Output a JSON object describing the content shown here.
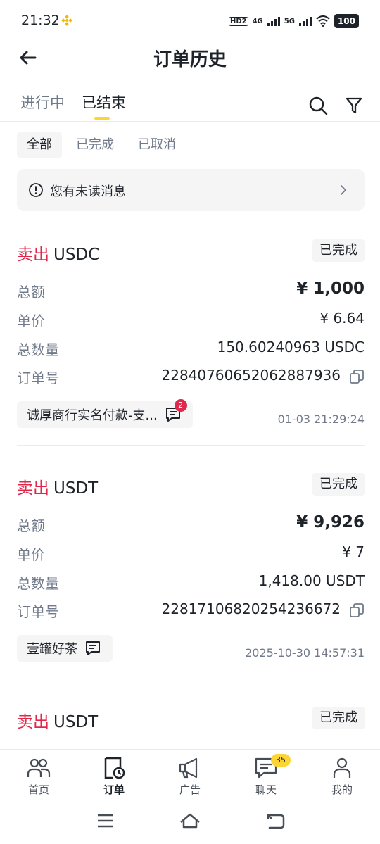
{
  "status_bar": {
    "time": "21:32",
    "signal_a": "4G",
    "signal_b": "5G",
    "battery": "100",
    "hd_label": "HD2"
  },
  "header": {
    "title": "订单历史"
  },
  "tabs": [
    {
      "label": "进行中"
    },
    {
      "label": "已结束"
    }
  ],
  "filters": [
    {
      "label": "全部"
    },
    {
      "label": "已完成"
    },
    {
      "label": "已取消"
    }
  ],
  "notice": {
    "text": "您有未读消息"
  },
  "orders": [
    {
      "side": "卖出",
      "coin": "USDC",
      "status": "已完成",
      "total_label": "总额",
      "total": "¥  1,000",
      "price_label": "单价",
      "price": "¥  6.64",
      "qty_label": "总数量",
      "qty": "150.60240963 USDC",
      "id_label": "订单号",
      "id": "22840760652062887936",
      "merchant": "诚厚商行实名付款-支...",
      "unread": "2",
      "time": "01-03 21:29:24"
    },
    {
      "side": "卖出",
      "coin": "USDT",
      "status": "已完成",
      "total_label": "总额",
      "total": "¥  9,926",
      "price_label": "单价",
      "price": "¥  7",
      "qty_label": "总数量",
      "qty": "1,418.00 USDT",
      "id_label": "订单号",
      "id": "22817106820254236672",
      "merchant": "壹罐好茶",
      "time": "2025-10-30 14:57:31"
    },
    {
      "side": "卖出",
      "coin": "USDT",
      "status": "已完成"
    }
  ],
  "bottom_nav": [
    {
      "label": "首页"
    },
    {
      "label": "订单"
    },
    {
      "label": "广告"
    },
    {
      "label": "聊天",
      "badge": "35"
    },
    {
      "label": "我的"
    }
  ],
  "colors": {
    "accent": "#fcd535",
    "sell": "#e0294a",
    "muted": "#707a8a",
    "text": "#1e2329",
    "chip_bg": "#f5f5f5"
  }
}
